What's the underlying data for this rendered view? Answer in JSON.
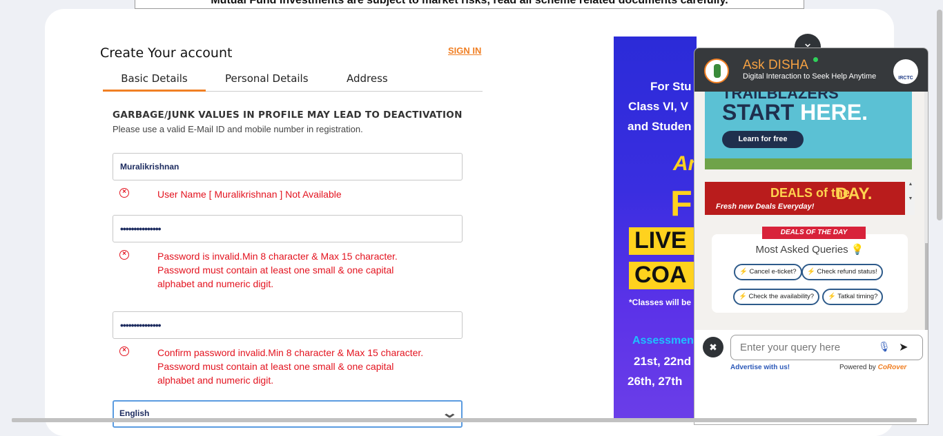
{
  "disclaimer": "Mutual Fund investments are subject to market risks, read all scheme related documents carefully.",
  "form": {
    "title": "Create Your account",
    "signin": "SIGN IN",
    "tabs": [
      "Basic Details",
      "Personal Details",
      "Address"
    ],
    "warning_title": "GARBAGE/JUNK VALUES IN PROFILE MAY LEAD TO DEACTIVATION",
    "warning_sub": "Please use a valid E-Mail ID and mobile number in registration.",
    "username_value": "Muralikrishnan",
    "username_error": "User Name [ Muralikrishnan ] Not Available",
    "password_value": "•••••••••••••••",
    "password_error_1": "Password is invalid.Min 8 character & Max 15 character.",
    "password_error_2": "Password must contain at least one small & one capital",
    "password_error_3": "alphabet and numeric digit.",
    "confirm_value": "•••••••••••••••",
    "confirm_error_1": "Confirm password invalid.Min 8 character & Max 15 character.",
    "confirm_error_2": "Password must contain at least one small & one capital",
    "confirm_error_3": "alphabet and numeric digit.",
    "language_value": "English"
  },
  "ad": {
    "line1": "For Stu",
    "line2": "Class VI, V",
    "line3": "and Studen",
    "script": "An",
    "big": "F",
    "box1": "LIVE",
    "box2": "COA",
    "note": "*Classes will be",
    "assess": "Assessmen",
    "dates1": "21st, 22nd",
    "dates2": "26th, 27th"
  },
  "disha": {
    "title": "Ask DISHA",
    "subtitle": "Digital Interaction to Seek Help Anytime",
    "irctc": "IRCTC",
    "promo_top": "TRAILBLAZERS",
    "promo_main_1": "START",
    "promo_main_2": "HERE.",
    "promo_button": "Learn for free",
    "deals_logo": "DEALS of the",
    "deals_day": "DAY.",
    "deals_tagline": "Fresh new Deals Everyday!",
    "ribbon": "DEALS OF THE DAY",
    "queries_title": "Most Asked Queries",
    "chips": [
      "Cancel e-ticket?",
      "Check refund status!",
      "Check the availability?",
      "Tatkal timing?"
    ],
    "placeholder": "Enter your query here",
    "advertise": "Advertise with us!",
    "powered": "Powered by",
    "brand": "CoRover"
  },
  "colors": {
    "accent": "#f07f23",
    "error": "#e3131f",
    "widget_header": "#36393c"
  }
}
